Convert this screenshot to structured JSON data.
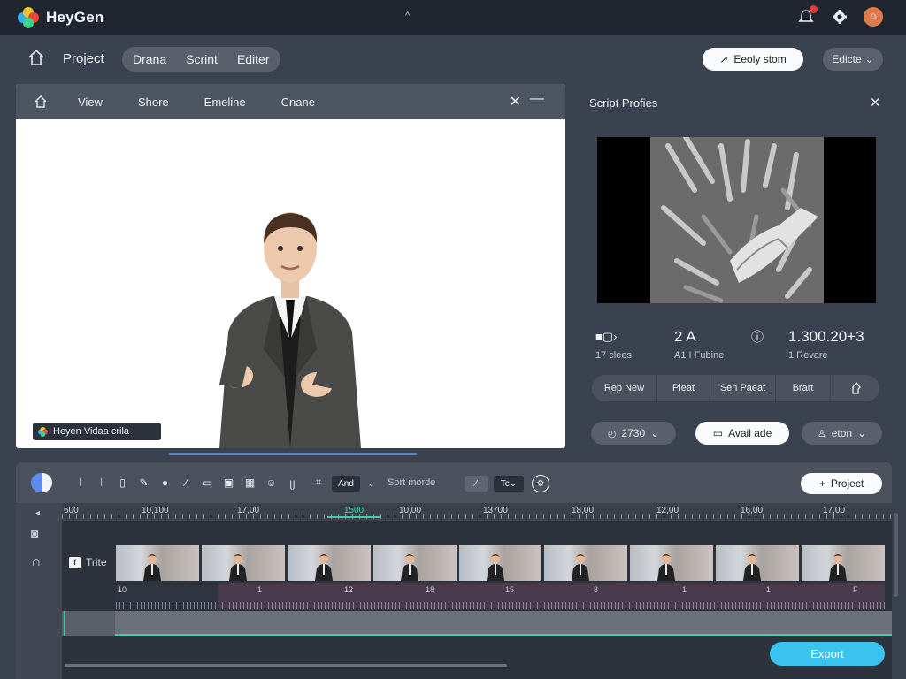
{
  "app": {
    "name": "HeyGen"
  },
  "header": {
    "project_label": "Project",
    "modes": [
      "Drana",
      "Scrint",
      "Editer"
    ],
    "primary_button": "Eeoly stom",
    "secondary_button": "Edicte"
  },
  "preview": {
    "tabs": [
      "View",
      "Shore",
      "Emeline",
      "Cnane"
    ],
    "watermark": "Heyen Vidaa crila"
  },
  "side_panel": {
    "title": "Script Profies",
    "stats": [
      {
        "value": "",
        "label": "17 clees"
      },
      {
        "value": "2 A",
        "label": "A1 I Fubine"
      },
      {
        "value": "",
        "label": ""
      },
      {
        "value": "1.300.20+3",
        "label": "1 Revare"
      }
    ],
    "actions": [
      "Rep New",
      "Pleat",
      "Sen Paeat",
      "Brart",
      ""
    ],
    "pill_left": "2730",
    "pill_mid": "Avail ade",
    "pill_right": "eton"
  },
  "timeline": {
    "tools": {
      "chip_and": "And",
      "chip_tc": "Tc",
      "sort_label": "Sort morde"
    },
    "project_button": "Project",
    "ruler": [
      "600",
      "10,100",
      "17,00",
      "1500",
      "10,00",
      "13700",
      "18,00",
      "12,00",
      "16,00",
      "17,00"
    ],
    "track_title": "Trite",
    "audio_marks": [
      "10",
      "1",
      "12",
      "18",
      "15",
      "8",
      "1",
      "1",
      "F"
    ],
    "export_button": "Export"
  },
  "colors": {
    "accent": "#3bc3ef",
    "timeline_highlight": "#3fd1a0",
    "bg": "#3a4250"
  }
}
